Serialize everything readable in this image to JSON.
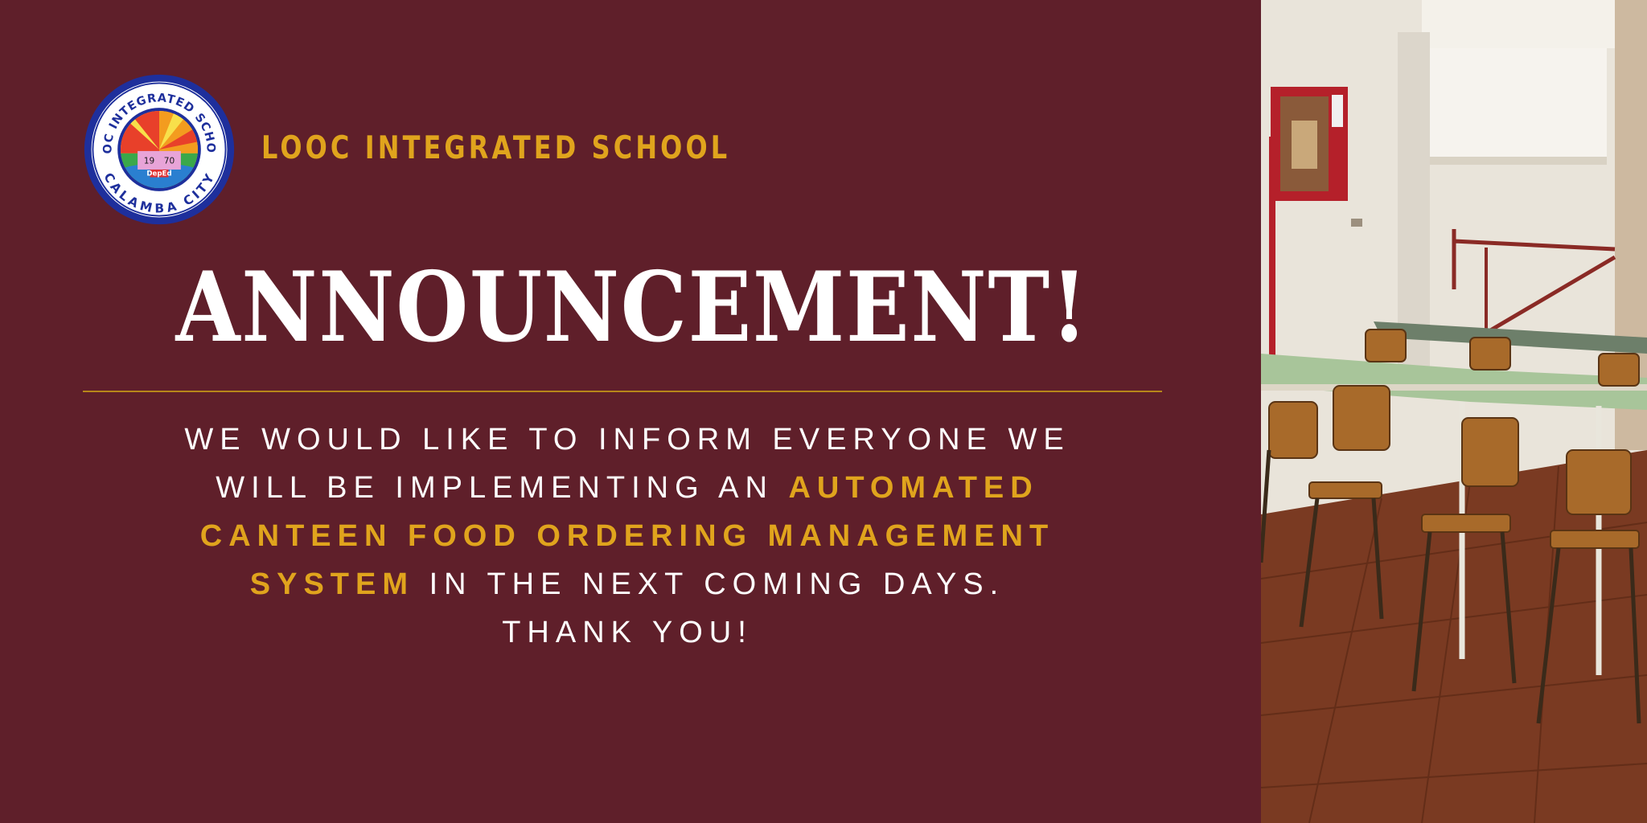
{
  "school": {
    "name": "LOOC INTEGRATED SCHOOL",
    "seal": {
      "top_text": "LOOC INTEGRATED SCHOOL",
      "bottom_text": "CALAMBA CITY",
      "year_left": "19",
      "year_right": "70",
      "badge_text": "DepEd"
    }
  },
  "headline": "ANNOUNCEMENT!",
  "message": {
    "line1": "WE WOULD LIKE TO INFORM EVERYONE WE",
    "line2_prefix": "WILL BE IMPLEMENTING AN ",
    "line2_highlight": "AUTOMATED",
    "line3_highlight": "CANTEEN FOOD ORDERING MANAGEMENT",
    "line4_highlight": "SYSTEM",
    "line4_suffix": " IN THE NEXT COMING DAYS.",
    "line5": "THANK YOU!"
  },
  "colors": {
    "background": "#5f1f2a",
    "accent": "#e0a41d",
    "text": "#ffffff"
  }
}
